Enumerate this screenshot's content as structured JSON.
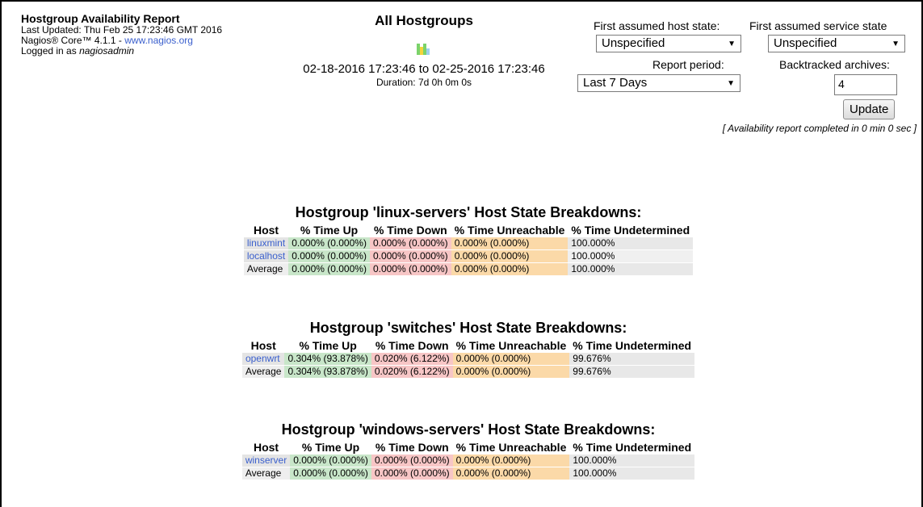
{
  "header": {
    "title": "Hostgroup Availability Report",
    "last_updated": "Last Updated: Thu Feb 25 17:23:46 GMT 2016",
    "core_prefix": "Nagios® Core™ 4.1.1 - ",
    "core_link": "www.nagios.org",
    "logged_prefix": "Logged in as ",
    "user": "nagiosadmin"
  },
  "center": {
    "hostgroup": "All Hostgroups",
    "range": "02-18-2016 17:23:46 to 02-25-2016 17:23:46",
    "duration": "Duration: 7d 0h 0m 0s"
  },
  "form": {
    "host_state_label": "First assumed host state:",
    "host_state_value": "Unspecified",
    "service_state_label": "First assumed service state",
    "service_state_value": "Unspecified",
    "report_period_label": "Report period:",
    "report_period_value": "Last 7 Days",
    "backtracked_label": "Backtracked archives:",
    "backtracked_value": "4",
    "update_label": "Update",
    "completed": "[ Availability report completed in 0 min 0 sec ]"
  },
  "columns": [
    "Host",
    "% Time Up",
    "% Time Down",
    "% Time Unreachable",
    "% Time Undetermined"
  ],
  "groups": [
    {
      "title": "Hostgroup 'linux-servers' Host State Breakdowns:",
      "rows": [
        {
          "host": "linuxmint",
          "up": "0.000% (0.000%)",
          "down": "0.000% (0.000%)",
          "unr": "0.000% (0.000%)",
          "und": "100.000%"
        },
        {
          "host": "localhost",
          "up": "0.000% (0.000%)",
          "down": "0.000% (0.000%)",
          "unr": "0.000% (0.000%)",
          "und": "100.000%"
        },
        {
          "host": "Average",
          "up": "0.000% (0.000%)",
          "down": "0.000% (0.000%)",
          "unr": "0.000% (0.000%)",
          "und": "100.000%"
        }
      ]
    },
    {
      "title": "Hostgroup 'switches' Host State Breakdowns:",
      "rows": [
        {
          "host": "openwrt",
          "up": "0.304% (93.878%)",
          "down": "0.020% (6.122%)",
          "unr": "0.000% (0.000%)",
          "und": "99.676%"
        },
        {
          "host": "Average",
          "up": "0.304% (93.878%)",
          "down": "0.020% (6.122%)",
          "unr": "0.000% (0.000%)",
          "und": "99.676%"
        }
      ]
    },
    {
      "title": "Hostgroup 'windows-servers' Host State Breakdowns:",
      "rows": [
        {
          "host": "winserver",
          "up": "0.000% (0.000%)",
          "down": "0.000% (0.000%)",
          "unr": "0.000% (0.000%)",
          "und": "100.000%"
        },
        {
          "host": "Average",
          "up": "0.000% (0.000%)",
          "down": "0.000% (0.000%)",
          "unr": "0.000% (0.000%)",
          "und": "100.000%"
        }
      ]
    }
  ],
  "colors": {
    "up": "#c8e6c9",
    "down": "#f7c6c6",
    "unreachable": "#fbd9a8",
    "undetermined": "#e8e8e8",
    "link": "#3a5fcd"
  },
  "icons": {
    "trend": "trend-chart-icon",
    "dropdown": "chevron-down-icon"
  }
}
